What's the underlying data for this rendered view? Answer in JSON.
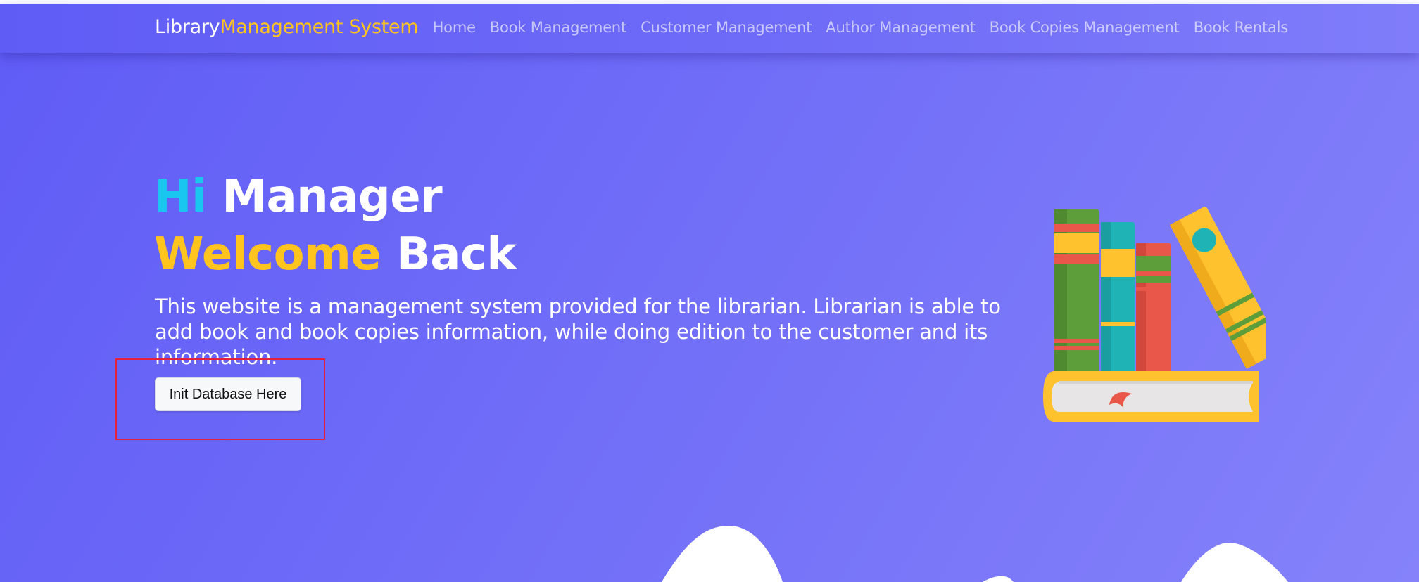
{
  "brand": {
    "part1": "Library",
    "part2": "Management System"
  },
  "nav": {
    "items": [
      {
        "label": "Home"
      },
      {
        "label": "Book Management"
      },
      {
        "label": "Customer Management"
      },
      {
        "label": "Author Management"
      },
      {
        "label": "Book Copies Management"
      },
      {
        "label": "Book Rentals"
      }
    ]
  },
  "hero": {
    "hi": "Hi",
    "manager": "Manager",
    "welcome": "Welcome",
    "back": "Back",
    "description": "This website is a management system provided for the librarian. Librarian is able to add book and book copies information, while doing edition to the customer and its information.",
    "button_label": "Init Database Here"
  },
  "colors": {
    "accent_yellow": "#ffc41d",
    "accent_cyan": "#18c6f0",
    "background": "#6a67f7",
    "highlight_box": "#e4203a"
  },
  "icons": [
    "books-illustration"
  ]
}
